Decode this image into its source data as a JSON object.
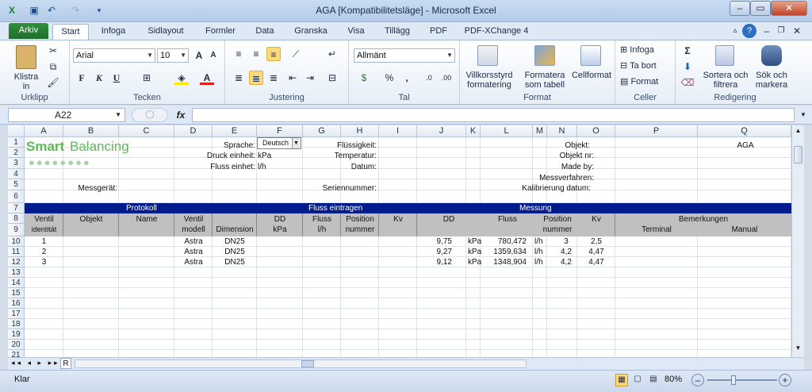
{
  "window": {
    "title": "AGA  [Kompatibilitetsläge]  -  Microsoft Excel"
  },
  "tabs": [
    "Arkiv",
    "Start",
    "Infoga",
    "Sidlayout",
    "Formler",
    "Data",
    "Granska",
    "Visa",
    "Tillägg",
    "PDF",
    "PDF-XChange 4"
  ],
  "ribbon": {
    "clipboard": {
      "paste_label": "Klistra\nin",
      "group": "Urklipp"
    },
    "font": {
      "name": "Arial",
      "size": "10",
      "group": "Tecken",
      "bold": "F",
      "italic": "K",
      "underline": "U"
    },
    "alignment": {
      "group": "Justering"
    },
    "number": {
      "format": "Allmänt",
      "group": "Tal",
      "percent": "%",
      "thousands": ","
    },
    "styles": {
      "cond": "Villkorsstyrd\nformatering",
      "table": "Formatera\nsom tabell",
      "cell": "Cellformat",
      "group": "Format"
    },
    "cells": {
      "insert": "Infoga",
      "delete": "Ta bort",
      "format": "Format",
      "group": "Celler"
    },
    "editing": {
      "sigma": "Σ",
      "sort": "Sortera och\nfiltrera",
      "find": "Sök och\nmarkera",
      "group": "Redigering"
    }
  },
  "formula_bar": {
    "name_box": "A22",
    "fx": "fx",
    "value": ""
  },
  "columns": [
    "A",
    "B",
    "C",
    "D",
    "E",
    "F",
    "G",
    "H",
    "I",
    "J",
    "K",
    "L",
    "M",
    "N",
    "O",
    "P",
    "Q"
  ],
  "rows": [
    "1",
    "2",
    "3",
    "4",
    "5",
    "6",
    "7",
    "8",
    "9",
    "10",
    "11",
    "12",
    "13",
    "14",
    "15",
    "16",
    "17",
    "18",
    "19",
    "20",
    "21"
  ],
  "logo": {
    "smart": "Smart",
    "balancing": "Balancing"
  },
  "header_cells": {
    "sprache_label": "Sprache:",
    "sprache_value": "Deutsch",
    "druck_label": "Druck einheit:",
    "druck_value": "kPa",
    "fluss_label": "Fluss einhet:",
    "fluss_value": "l/h",
    "messgeraet": "Messgerät:",
    "fluessigkeit": "Flüssigkeit:",
    "temperatur": "Temperatur:",
    "datum": "Datum:",
    "seriennummer": "Seriennummer:",
    "objekt": "Objekt:",
    "objekt_value": "AGA",
    "objekt_nr": "Objekt nr:",
    "made_by": "Made by:",
    "messverfahren": "Messverfahren:",
    "kalibrierung": "Kalibrierung datum:"
  },
  "bands": {
    "protokoll": "Protokoll",
    "fluss_eintragen": "Fluss eintragen",
    "messung": "Messung"
  },
  "table_headers": {
    "ventil": "Ventil",
    "identitaet": "identität",
    "objekt": "Objekt",
    "name": "Name",
    "ventil2": "Ventil",
    "modell": "modell",
    "dimension": "Dimension",
    "dd": "DD",
    "kpa": "kPa",
    "fluss": "Fluss",
    "lh": "l/h",
    "position": "Position",
    "nummer": "nummer",
    "kv": "Kv",
    "m_dd": "DD",
    "m_fluss": "Fluss",
    "m_position": "Position",
    "m_nummer": "nummer",
    "m_kv": "Kv",
    "bemerkungen": "Bemerkungen",
    "terminal": "Terminal",
    "manual": "Manual"
  },
  "data_rows": [
    {
      "id": "1",
      "modell": "Astra",
      "dim": "DN25",
      "dd": "9,75",
      "unit1": "kPa",
      "fluss": "780,472",
      "unit2": "l/h",
      "pos": "3",
      "kv": "2,5"
    },
    {
      "id": "2",
      "modell": "Astra",
      "dim": "DN25",
      "dd": "9,27",
      "unit1": "kPa",
      "fluss": "1359,634",
      "unit2": "l/h",
      "pos": "4,2",
      "kv": "4,47"
    },
    {
      "id": "3",
      "modell": "Astra",
      "dim": "DN25",
      "dd": "9,12",
      "unit1": "kPa",
      "fluss": "1348,904",
      "unit2": "l/h",
      "pos": "4,2",
      "kv": "4,47"
    }
  ],
  "sheet_tab": "R",
  "status": {
    "ready": "Klar",
    "zoom": "80%"
  },
  "colors": {
    "band": "#001b8c",
    "header_gray": "#c0c0c0",
    "logo_green": "#5fb85a",
    "file_tab": "#2a7f36"
  }
}
